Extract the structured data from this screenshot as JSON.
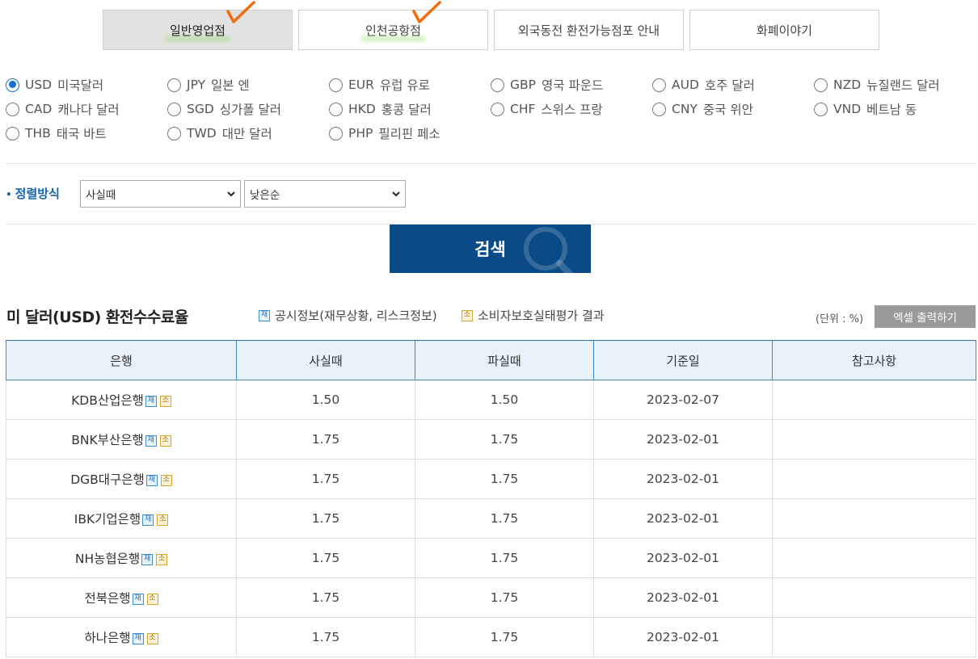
{
  "tabs": [
    {
      "label": "일반영업점",
      "active": true,
      "checked": true
    },
    {
      "label": "인천공항점",
      "active": false,
      "checked": true
    },
    {
      "label": "외국동전 환전가능점포 안내",
      "active": false,
      "checked": false
    },
    {
      "label": "화폐이야기",
      "active": false,
      "checked": false
    }
  ],
  "currencies": [
    [
      {
        "code": "USD",
        "name": "미국달러",
        "checked": true
      },
      {
        "code": "JPY",
        "name": "일본 엔",
        "checked": false
      },
      {
        "code": "EUR",
        "name": "유럽 유로",
        "checked": false
      },
      {
        "code": "GBP",
        "name": "영국 파운드",
        "checked": false
      },
      {
        "code": "AUD",
        "name": "호주 달러",
        "checked": false
      },
      {
        "code": "NZD",
        "name": "뉴질랜드 달러",
        "checked": false
      }
    ],
    [
      {
        "code": "CAD",
        "name": "캐나다 달러",
        "checked": false
      },
      {
        "code": "SGD",
        "name": "싱가폴 달러",
        "checked": false
      },
      {
        "code": "HKD",
        "name": "홍콩 달러",
        "checked": false
      },
      {
        "code": "CHF",
        "name": "스위스 프랑",
        "checked": false
      },
      {
        "code": "CNY",
        "name": "중국 위안",
        "checked": false
      },
      {
        "code": "VND",
        "name": "베트남 동",
        "checked": false
      }
    ],
    [
      {
        "code": "THB",
        "name": "태국 바트",
        "checked": false
      },
      {
        "code": "TWD",
        "name": "대만 달러",
        "checked": false
      },
      {
        "code": "PHP",
        "name": "필리핀 페소",
        "checked": false
      }
    ]
  ],
  "sort": {
    "label": "정렬방식",
    "field_value": "사실때",
    "order_value": "낮은순"
  },
  "search_label": "검색",
  "section": {
    "title": "미 달러(USD) 환전수수료율",
    "legend_disclosure": "공시정보(재무상황, 리스크정보)",
    "legend_consumer": "소비자보호실태평가 결과",
    "unit": "(단위 : %)",
    "excel_label": "엑셀 출력하기",
    "badge_disclosure": "재",
    "badge_consumer": "소"
  },
  "table": {
    "headers": [
      "은행",
      "사실때",
      "파실때",
      "기준일",
      "참고사항"
    ],
    "rows": [
      {
        "bank": "KDB산업은행",
        "buy": "1.50",
        "sell": "1.50",
        "date": "2023-02-07",
        "note": ""
      },
      {
        "bank": "BNK부산은행",
        "buy": "1.75",
        "sell": "1.75",
        "date": "2023-02-01",
        "note": ""
      },
      {
        "bank": "DGB대구은행",
        "buy": "1.75",
        "sell": "1.75",
        "date": "2023-02-01",
        "note": ""
      },
      {
        "bank": "IBK기업은행",
        "buy": "1.75",
        "sell": "1.75",
        "date": "2023-02-01",
        "note": ""
      },
      {
        "bank": "NH농협은행",
        "buy": "1.75",
        "sell": "1.75",
        "date": "2023-02-01",
        "note": ""
      },
      {
        "bank": "전북은행",
        "buy": "1.75",
        "sell": "1.75",
        "date": "2023-02-01",
        "note": ""
      },
      {
        "bank": "하나은행",
        "buy": "1.75",
        "sell": "1.75",
        "date": "2023-02-01",
        "note": ""
      }
    ]
  },
  "colors": {
    "primary": "#0a4a87",
    "accent_blue": "#1565b0",
    "check_mark": "#f26b0f",
    "table_header_bg": "#e6f1f9"
  }
}
